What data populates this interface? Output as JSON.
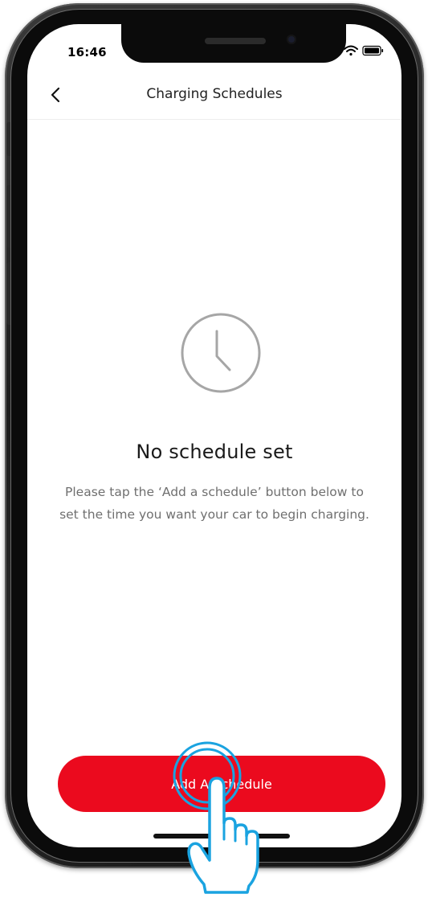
{
  "status_bar": {
    "time": "16:46"
  },
  "header": {
    "back_icon": "chevron-left-icon",
    "title": "Charging Schedules"
  },
  "empty_state": {
    "icon": "clock-icon",
    "title": "No schedule set",
    "description": "Please tap the ‘Add a schedule’ button below to set the time you want your car to begin charging."
  },
  "cta": {
    "label": "Add A Schedule"
  },
  "colors": {
    "accent": "#eb0a1e",
    "touch_highlight": "#1aa3e0",
    "clock_stroke": "#a6a6a6",
    "text_primary": "#1a1a1a",
    "text_secondary": "#6f6f6f"
  }
}
